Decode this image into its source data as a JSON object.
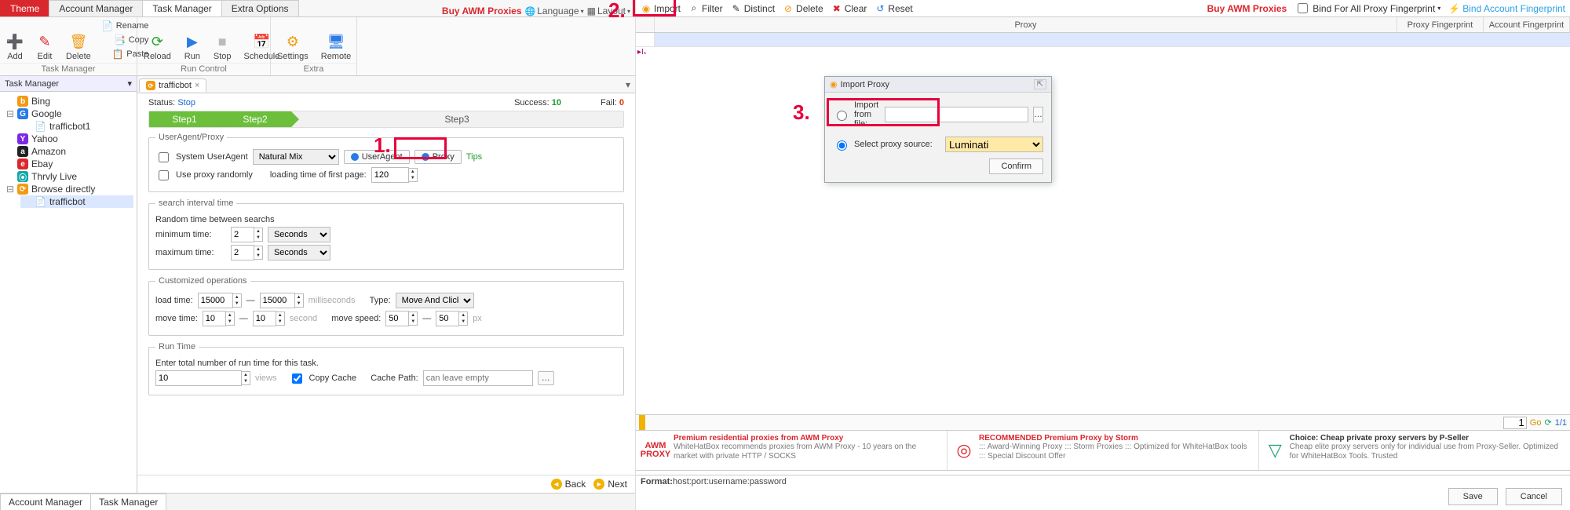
{
  "left": {
    "tabs": [
      "Theme",
      "Account Manager",
      "Task Manager",
      "Extra Options"
    ],
    "active_tab": "Task Manager",
    "top_links": {
      "buy": "Buy AWM Proxies",
      "language": "Language",
      "layout": "Layout"
    },
    "ribbon": {
      "group1": {
        "caption": "",
        "btns": [
          {
            "label": "Add",
            "icon": "plus"
          },
          {
            "label": "Edit",
            "icon": "edit"
          },
          {
            "label": "Delete",
            "icon": "delete"
          }
        ],
        "side": [
          {
            "label": "Rename",
            "icon": "rename"
          },
          {
            "label": "Copy",
            "icon": "copy"
          },
          {
            "label": "Paste",
            "icon": "paste"
          }
        ]
      },
      "group1_caption": "Task Manager",
      "group2": {
        "caption": "Run Control",
        "btns": [
          {
            "label": "Reload",
            "icon": "reload"
          },
          {
            "label": "Run",
            "icon": "run"
          },
          {
            "label": "Stop",
            "icon": "stop"
          },
          {
            "label": "Schedule",
            "icon": "schedule"
          }
        ]
      },
      "group3": {
        "caption": "Extra",
        "btns": [
          {
            "label": "Settings",
            "icon": "settings"
          },
          {
            "label": "Remote",
            "icon": "remote"
          }
        ]
      }
    },
    "sidebar": {
      "title": "Task Manager",
      "items": [
        {
          "name": "Bing",
          "icon_bg": "bg-orange",
          "icon_txt": "b",
          "expand": ""
        },
        {
          "name": "Google",
          "icon_bg": "bg-blue",
          "icon_txt": "G",
          "expand": "-",
          "children": [
            {
              "name": "trafficbot1"
            }
          ]
        },
        {
          "name": "Yahoo",
          "icon_bg": "bg-purple",
          "icon_txt": "Y",
          "expand": ""
        },
        {
          "name": "Amazon",
          "icon_bg": "bg-black",
          "icon_txt": "a",
          "expand": ""
        },
        {
          "name": "Ebay",
          "icon_bg": "bg-red",
          "icon_txt": "e",
          "expand": ""
        },
        {
          "name": "Thrvly Live",
          "icon_bg": "bg-teal",
          "icon_txt": "⦿",
          "expand": ""
        },
        {
          "name": "Browse directly",
          "icon_bg": "bg-orange",
          "icon_txt": "⟳",
          "expand": "-",
          "children": [
            {
              "name": "trafficbot"
            }
          ]
        }
      ]
    },
    "doc": {
      "tab": "trafficbot",
      "status_label": "Status:",
      "status_value": "Stop",
      "success_label": "Success:",
      "success_value": "10",
      "fail_label": "Fail:",
      "fail_value": "0",
      "steps": [
        "Step1",
        "Step2",
        "Step3"
      ],
      "ua_legend": "UserAgent/Proxy",
      "sys_ua": "System UserAgent",
      "ua_combo": "Natural Mix",
      "useragent_btn": "UserAgent",
      "proxy_btn": "Proxy",
      "tips": "Tips",
      "random_proxy": "Use proxy randomly",
      "load_first_label": "loading time of first page:",
      "load_first_value": "120",
      "search_legend": "search interval time",
      "search_desc": "Random time between searchs",
      "min_label": "minimum time:",
      "min_value": "2",
      "max_label": "maximum time:",
      "max_value": "2",
      "unit": "Seconds",
      "custom_legend": "Customized operations",
      "load_time_label": "load time:",
      "lt1": "15000",
      "lt2": "15000",
      "lt_unit": "milliseconds",
      "type_label": "Type:",
      "type_value": "Move And Click",
      "move_time_label": "move time:",
      "mt1": "10",
      "mt2": "10",
      "mt_unit": "second",
      "move_speed_label": "move speed:",
      "ms1": "50",
      "ms2": "50",
      "ms_unit": "px",
      "run_legend": "Run Time",
      "run_desc": "Enter total number of run time for this task.",
      "run_value": "10",
      "views": "views",
      "copycache": "Copy Cache",
      "cache_label": "Cache Path:",
      "cache_placeholder": "can leave empty",
      "back": "Back",
      "next": "Next",
      "bottom_tabs": [
        "Account Manager",
        "Task Manager"
      ]
    },
    "annotation": {
      "label": "1."
    }
  },
  "right": {
    "toolbar": [
      {
        "label": "Import",
        "icon": "⊕",
        "ic_color": "c-orange"
      },
      {
        "label": "Filter",
        "icon": "⌕",
        "ic_color": ""
      },
      {
        "label": "Distinct",
        "icon": "✎",
        "ic_color": ""
      },
      {
        "label": "Delete",
        "icon": "⊘",
        "ic_color": "c-orange"
      },
      {
        "label": "Clear",
        "icon": "✖",
        "ic_color": "c-red"
      },
      {
        "label": "Reset",
        "icon": "↺",
        "ic_color": "c-blue"
      }
    ],
    "right": {
      "buy": "Buy AWM Proxies",
      "bind_all": "Bind For All Proxy Fingerprint",
      "bind_account": "Bind Account Fingerprint"
    },
    "grid": {
      "cols": [
        "Proxy",
        "Proxy Fingerprint",
        "Account Fingerprint"
      ]
    },
    "dialog": {
      "title": "Import Proxy",
      "opt_file": "Import from file:",
      "opt_source": "Select proxy source:",
      "source_value": "Luminati",
      "confirm": "Confirm"
    },
    "footer": {
      "page_input": "1",
      "go": "Go",
      "page": "1/1"
    },
    "ads": [
      {
        "logo": "AWM PROXY",
        "title": "Premium residential proxies from AWM Proxy",
        "text": "WhiteHatBox recommends proxies from AWM Proxy - 10 years on the market with private HTTP / SOCKS"
      },
      {
        "logo": "◎",
        "title": "RECOMMENDED Premium Proxy by Storm",
        "text": "::: Award-Winning Proxy ::: Storm Proxies ::: Optimized for WhiteHatBox tools ::: Special Discount Offer"
      },
      {
        "logo": "▽",
        "title": "Choice: Cheap private proxy servers by P-Seller",
        "text": "Cheap elite proxy servers only for individual use from Proxy-Seller. Optimized for WhiteHatBox Tools. Trusted"
      }
    ],
    "hint_label": "Format:",
    "hint": "host:port:username:password",
    "save": "Save",
    "cancel": "Cancel",
    "annotation2": {
      "label": "2."
    },
    "annotation3": {
      "label": "3."
    }
  }
}
